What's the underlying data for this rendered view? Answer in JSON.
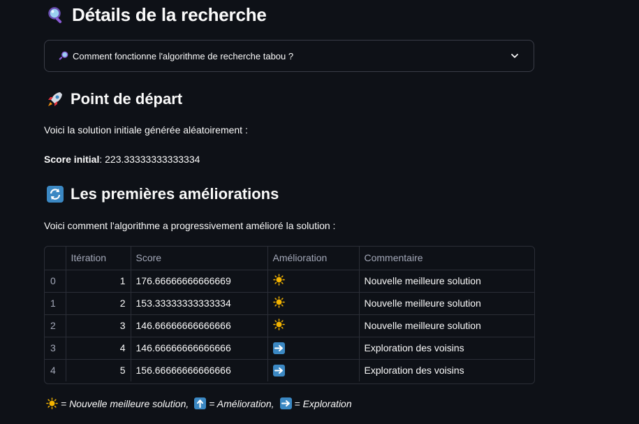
{
  "header": {
    "title": "Détails de la recherche",
    "title_icon": "magnifier-icon"
  },
  "expander": {
    "label": "Comment fonctionne l'algorithme de recherche tabou ?",
    "icon": "magnifier-icon"
  },
  "start": {
    "title": "Point de départ",
    "title_icon": "rocket-icon",
    "description": "Voici la solution initiale générée aléatoirement :",
    "score_label": "Score initial",
    "score_value": ": 223.33333333333334"
  },
  "improvements": {
    "title": "Les premières améliorations",
    "title_icon": "refresh-icon",
    "description": "Voici comment l'algorithme a progressivement amélioré la solution :"
  },
  "table": {
    "columns": [
      "",
      "Itération",
      "Score",
      "Amélioration",
      "Commentaire"
    ],
    "rows": [
      {
        "index": "0",
        "iteration": "1",
        "score": "176.66666666666669",
        "icon": "sun-icon",
        "comment": "Nouvelle meilleure solution"
      },
      {
        "index": "1",
        "iteration": "2",
        "score": "153.33333333333334",
        "icon": "sun-icon",
        "comment": "Nouvelle meilleure solution"
      },
      {
        "index": "2",
        "iteration": "3",
        "score": "146.66666666666666",
        "icon": "sun-icon",
        "comment": "Nouvelle meilleure solution"
      },
      {
        "index": "3",
        "iteration": "4",
        "score": "146.66666666666666",
        "icon": "right-arrow-icon",
        "comment": "Exploration des voisins"
      },
      {
        "index": "4",
        "iteration": "5",
        "score": "156.66666666666666",
        "icon": "right-arrow-icon",
        "comment": "Exploration des voisins"
      }
    ]
  },
  "legend": {
    "sun": "= Nouvelle meilleure solution,",
    "up": "= Amélioration,",
    "right": "= Exploration"
  },
  "colors": {
    "background": "#0e1117",
    "text": "#fafafa",
    "muted": "#a3a8b8",
    "border": "#2b2e37",
    "arrow_box": "#3b88c3",
    "sun": "#f4b400"
  }
}
